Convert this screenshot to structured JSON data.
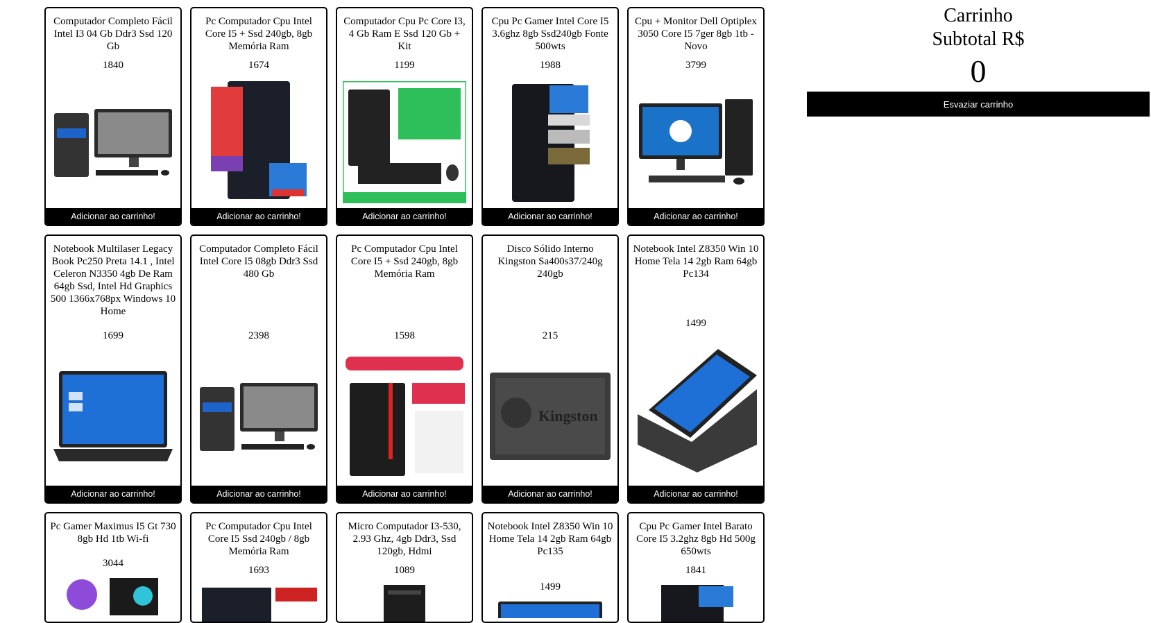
{
  "cart": {
    "title": "Carrinho",
    "subtotal_label": "Subtotal R$",
    "total": "0",
    "empty_label": "Esvaziar carrinho"
  },
  "add_label": "Adicionar ao carrinho!",
  "products": [
    {
      "title": "Computador Completo Fácil Intel I3 04 Gb Ddr3 Ssd 120 Gb",
      "price": "1840",
      "image": "desktop-with-monitor"
    },
    {
      "title": "Pc Computador Cpu Intel Core I5 + Ssd 240gb, 8gb Memória Ram",
      "price": "1674",
      "image": "tower-case"
    },
    {
      "title": "Computador Cpu Pc Core I3, 4 Gb Ram E Ssd 120 Gb + Kit",
      "price": "1199",
      "image": "tower-with-keyboard"
    },
    {
      "title": "Cpu Pc Gamer Intel Core I5 3.6ghz 8gb Ssd240gb Fonte 500wts",
      "price": "1988",
      "image": "gamer-tower"
    },
    {
      "title": "Cpu + Monitor Dell Optiplex 3050 Core I5 7ger 8gb 1tb - Novo",
      "price": "3799",
      "image": "dell-desktop"
    },
    {
      "title": "Notebook Multilaser Legacy Book Pc250 Preta 14.1 , Intel Celeron N3350 4gb De Ram 64gb Ssd, Intel Hd Graphics 500 1366x768px Windows 10 Home",
      "price": "1699",
      "image": "laptop-windows"
    },
    {
      "title": "Computador Completo Fácil Intel Core I5 08gb Ddr3 Ssd 480 Gb",
      "price": "2398",
      "image": "desktop-with-monitor"
    },
    {
      "title": "Pc Computador Cpu Intel Core I5 + Ssd 240gb, 8gb Memória Ram",
      "price": "1598",
      "image": "promo-tower"
    },
    {
      "title": "Disco Sólido Interno Kingston Sa400s37/240g 240gb",
      "price": "215",
      "image": "kingston-ssd"
    },
    {
      "title": "Notebook Intel Z8350 Win 10 Home Tela 14 2gb Ram 64gb Pc134",
      "price": "1499",
      "image": "laptop-angled"
    },
    {
      "title": "Pc Gamer Maximus I5 Gt 730 8gb Hd 1tb Wi-fi",
      "price": "3044",
      "image": "gamer-rgb"
    },
    {
      "title": "Pc Computador Cpu Intel Core I5 Ssd 240gb / 8gb Memória Ram",
      "price": "1693",
      "image": "tower-case"
    },
    {
      "title": "Micro Computador I3-530, 2.93 Ghz, 4gb Ddr3, Ssd 120gb, Hdmi",
      "price": "1089",
      "image": "tower-front"
    },
    {
      "title": "Notebook Intel Z8350 Win 10 Home Tela 14 2gb Ram 64gb Pc135",
      "price": "1499",
      "image": "laptop-blue"
    },
    {
      "title": "Cpu Pc Gamer Intel Barato Core I5 3.2ghz 8gb Hd 500g 650wts",
      "price": "1841",
      "image": "gamer-tower"
    }
  ]
}
